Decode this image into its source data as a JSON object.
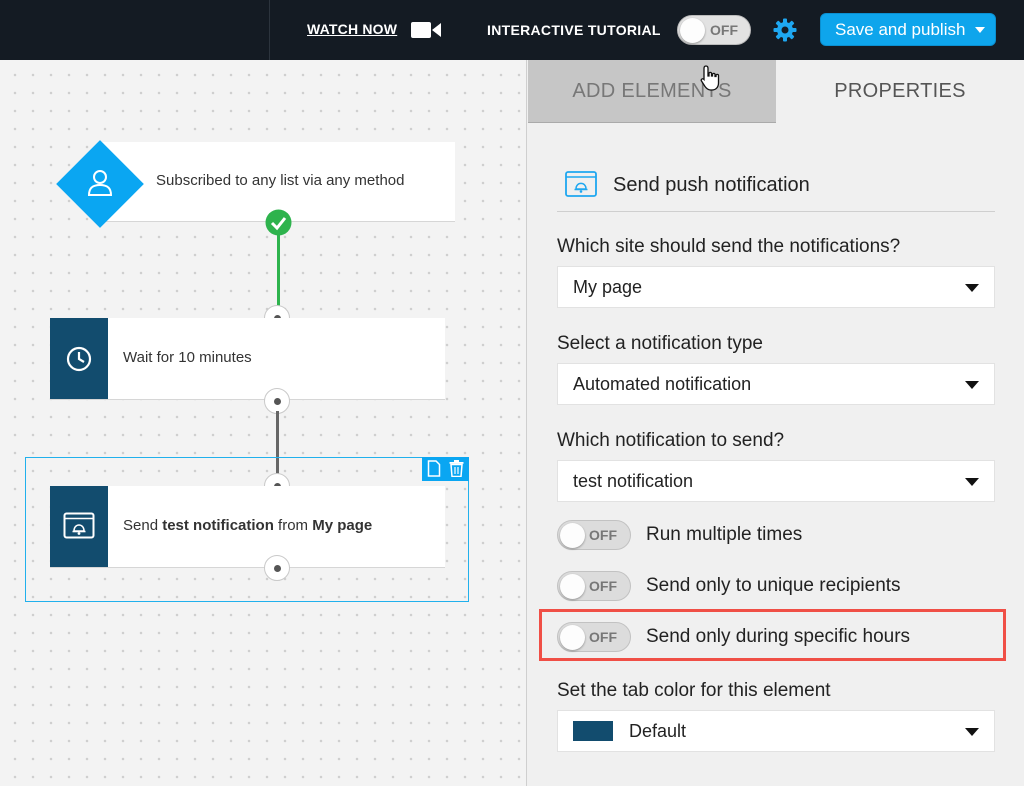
{
  "topbar": {
    "watch_now": "WATCH NOW",
    "tutorial_label": "INTERACTIVE TUTORIAL",
    "tutorial_toggle": "OFF",
    "save_publish": "Save and publish"
  },
  "canvas": {
    "trigger_text": "Subscribed to any list via any method",
    "wait_text": "Wait for 10 minutes",
    "send": {
      "prefix": "Send ",
      "notification": "test notification",
      "middle": " from ",
      "site": "My page"
    }
  },
  "panel": {
    "tabs": [
      {
        "label": "ADD ELEMENTS"
      },
      {
        "label": "PROPERTIES"
      }
    ],
    "heading": "Send push notification",
    "site_question": "Which site should send the notifications?",
    "site_value": "My page",
    "type_question": "Select a notification type",
    "type_value": "Automated notification",
    "which_question": "Which notification to send?",
    "which_value": "test notification",
    "toggles": [
      {
        "state": "OFF",
        "label": "Run multiple times"
      },
      {
        "state": "OFF",
        "label": "Send only to unique recipients"
      },
      {
        "state": "OFF",
        "label": "Send only during specific hours"
      }
    ],
    "color_question": "Set the tab color for this element",
    "color_value": "Default"
  },
  "colors": {
    "topbar_bg": "#141b23",
    "accent_blue": "#0aa6f2",
    "node_side": "#124c6e",
    "success_green": "#2eb34d",
    "highlight_red": "#f04f46"
  }
}
